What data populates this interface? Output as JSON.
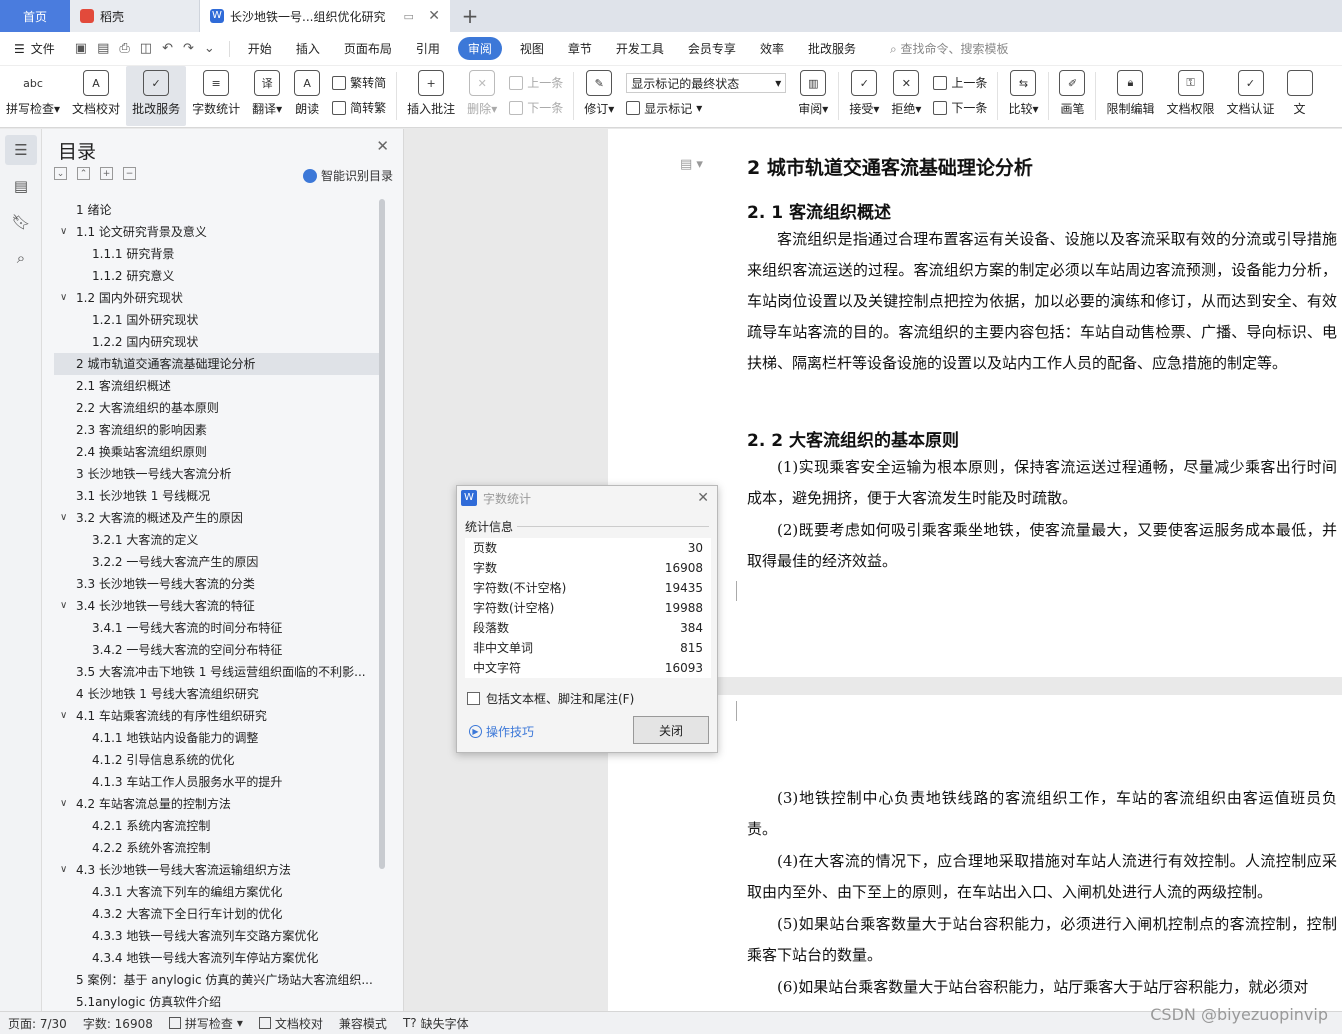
{
  "tabs": {
    "home": "首页",
    "doc1": "稻壳",
    "doc2": "长沙地铁一号...组织优化研究"
  },
  "menu": {
    "file": "文件",
    "items": [
      "开始",
      "插入",
      "页面布局",
      "引用",
      "审阅",
      "视图",
      "章节",
      "开发工具",
      "会员专享",
      "效率",
      "批改服务"
    ],
    "active": "审阅",
    "search": "查找命令、搜索模板"
  },
  "ribbon": {
    "spell": "拼写检查",
    "spell_icon_text": "abc",
    "doc_proof": "文档校对",
    "correction": "批改服务",
    "wordcount": "字数统计",
    "translate": "翻译",
    "read": "朗读",
    "trad": "繁转简",
    "simp": "简转繁",
    "insert_comment": "插入批注",
    "delete": "删除",
    "prev": "上一条",
    "next": "下一条",
    "revise": "修订",
    "show_select": "显示标记的最终状态",
    "show_mark": "显示标记",
    "review": "审阅",
    "accept": "接受",
    "reject": "拒绝",
    "prev2": "上一条",
    "next2": "下一条",
    "compare": "比较",
    "pen": "画笔",
    "restrict": "限制编辑",
    "perm": "文档权限",
    "cert": "文档认证",
    "more": "文"
  },
  "toc": {
    "title": "目录",
    "smart": "智能识别目录",
    "items": [
      {
        "level": 1,
        "text": "1 绪论",
        "chev": false
      },
      {
        "level": 1,
        "text": "1.1  论文研究背景及意义",
        "chev": true
      },
      {
        "level": 2,
        "text": "1.1.1  研究背景",
        "chev": false
      },
      {
        "level": 2,
        "text": "1.1.2 研究意义",
        "chev": false
      },
      {
        "level": 1,
        "text": "1.2 国内外研究现状",
        "chev": true
      },
      {
        "level": 2,
        "text": "1.2.1 国外研究现状",
        "chev": false
      },
      {
        "level": 2,
        "text": "1.2.2 国内研究现状",
        "chev": false
      },
      {
        "level": 1,
        "text": "2  城市轨道交通客流基础理论分析",
        "chev": false,
        "selected": true
      },
      {
        "level": 1,
        "text": "2.1 客流组织概述",
        "chev": false
      },
      {
        "level": 1,
        "text": "2.2 大客流组织的基本原则",
        "chev": false
      },
      {
        "level": 1,
        "text": "2.3 客流组织的影响因素",
        "chev": false
      },
      {
        "level": 1,
        "text": "2.4 换乘站客流组织原则",
        "chev": false
      },
      {
        "level": 1,
        "text": "3 长沙地铁一号线大客流分析",
        "chev": false
      },
      {
        "level": 1,
        "text": "3.1 长沙地铁 1 号线概况",
        "chev": false
      },
      {
        "level": 1,
        "text": "3.2 大客流的概述及产生的原因",
        "chev": true
      },
      {
        "level": 2,
        "text": "3.2.1 大客流的定义",
        "chev": false
      },
      {
        "level": 2,
        "text": "3.2.2 一号线大客流产生的原因",
        "chev": false
      },
      {
        "level": 1,
        "text": "3.3 长沙地铁一号线大客流的分类",
        "chev": false
      },
      {
        "level": 1,
        "text": "3.4 长沙地铁一号线大客流的特征",
        "chev": true
      },
      {
        "level": 2,
        "text": "3.4.1 一号线大客流的时间分布特征",
        "chev": false
      },
      {
        "level": 2,
        "text": "3.4.2 一号线大客流的空间分布特征",
        "chev": false
      },
      {
        "level": 1,
        "text": "3.5 大客流冲击下地铁 1 号线运营组织面临的不利影...",
        "chev": false
      },
      {
        "level": 1,
        "text": "4 长沙地铁 1 号线大客流组织研究",
        "chev": false
      },
      {
        "level": 1,
        "text": "4.1 车站乘客流线的有序性组织研究",
        "chev": true
      },
      {
        "level": 2,
        "text": "4.1.1 地铁站内设备能力的调整",
        "chev": false
      },
      {
        "level": 2,
        "text": "4.1.2 引导信息系统的优化",
        "chev": false
      },
      {
        "level": 2,
        "text": "4.1.3 车站工作人员服务水平的提升",
        "chev": false
      },
      {
        "level": 1,
        "text": "4.2 车站客流总量的控制方法",
        "chev": true
      },
      {
        "level": 2,
        "text": "4.2.1 系统内客流控制",
        "chev": false
      },
      {
        "level": 2,
        "text": "4.2.2 系统外客流控制",
        "chev": false
      },
      {
        "level": 1,
        "text": "4.3 长沙地铁一号线大客流运输组织方法",
        "chev": true
      },
      {
        "level": 2,
        "text": "4.3.1 大客流下列车的编组方案优化",
        "chev": false
      },
      {
        "level": 2,
        "text": "4.3.2 大客流下全日行车计划的优化",
        "chev": false
      },
      {
        "level": 2,
        "text": "4.3.3 地铁一号线大客流列车交路方案优化",
        "chev": false
      },
      {
        "level": 2,
        "text": "4.3.4 地铁一号线大客流列车停站方案优化",
        "chev": false
      },
      {
        "level": 1,
        "text": "5 案例：基于 anylogic 仿真的黄兴广场站大客流组织...",
        "chev": false
      },
      {
        "level": 1,
        "text": "5.1anylogic 仿真软件介绍",
        "chev": false
      }
    ]
  },
  "doc": {
    "h1": "2  城市轨道交通客流基础理论分析",
    "h2a": "2. 1 客流组织概述",
    "p1": "客流组织是指通过合理布置客运有关设备、设施以及客流采取有效的分流或引导措施来组织客流运送的过程。客流组织方案的制定必须以车站周边客流预测，设备能力分析，车站岗位设置以及关键控制点把控为依据，加以必要的演练和修订，从而达到安全、有效疏导车站客流的目的。客流组织的主要内容包括：车站自动售检票、广播、导向标识、电扶梯、隔离栏杆等设备设施的设置以及站内工作人员的配备、应急措施的制定等。",
    "h2b": "2. 2 大客流组织的基本原则",
    "p2": "(1)实现乘客安全运输为根本原则，保持客流运送过程通畅，尽量减少乘客出行时间成本，避免拥挤，便于大客流发生时能及时疏散。",
    "p3": "(2)既要考虑如何吸引乘客乘坐地铁，使客流量最大，又要使客运服务成本最低，并取得最佳的经济效益。",
    "p4": "(3)地铁控制中心负责地铁线路的客流组织工作，车站的客流组织由客运值班员负责。",
    "p5": "(4)在大客流的情况下，应合理地采取措施对车站人流进行有效控制。人流控制应采取由内至外、由下至上的原则，在车站出入口、入闸机处进行人流的两级控制。",
    "p6": "(5)如果站台乘客数量大于站台容积能力，必须进行入闸机控制点的客流控制，控制乘客下站台的数量。",
    "p7": "(6)如果站台乘客数量大于站台容积能力，站厅乘客大于站厅容积能力，就必须对"
  },
  "dialog": {
    "title": "字数统计",
    "section": "统计信息",
    "rows": [
      {
        "label": "页数",
        "value": "30"
      },
      {
        "label": "字数",
        "value": "16908"
      },
      {
        "label": "字符数(不计空格)",
        "value": "19435"
      },
      {
        "label": "字符数(计空格)",
        "value": "19988"
      },
      {
        "label": "段落数",
        "value": "384"
      },
      {
        "label": "非中文单词",
        "value": "815"
      },
      {
        "label": "中文字符",
        "value": "16093"
      }
    ],
    "checkbox": "包括文本框、脚注和尾注(F)",
    "tip": "操作技巧",
    "close": "关闭"
  },
  "status": {
    "page": "页面: 7/30",
    "words": "字数: 16908",
    "spell": "拼写检查",
    "proof": "文档校对",
    "compat": "兼容模式",
    "missing_font": "缺失字体"
  },
  "watermark": "CSDN @biyezuopinvip"
}
